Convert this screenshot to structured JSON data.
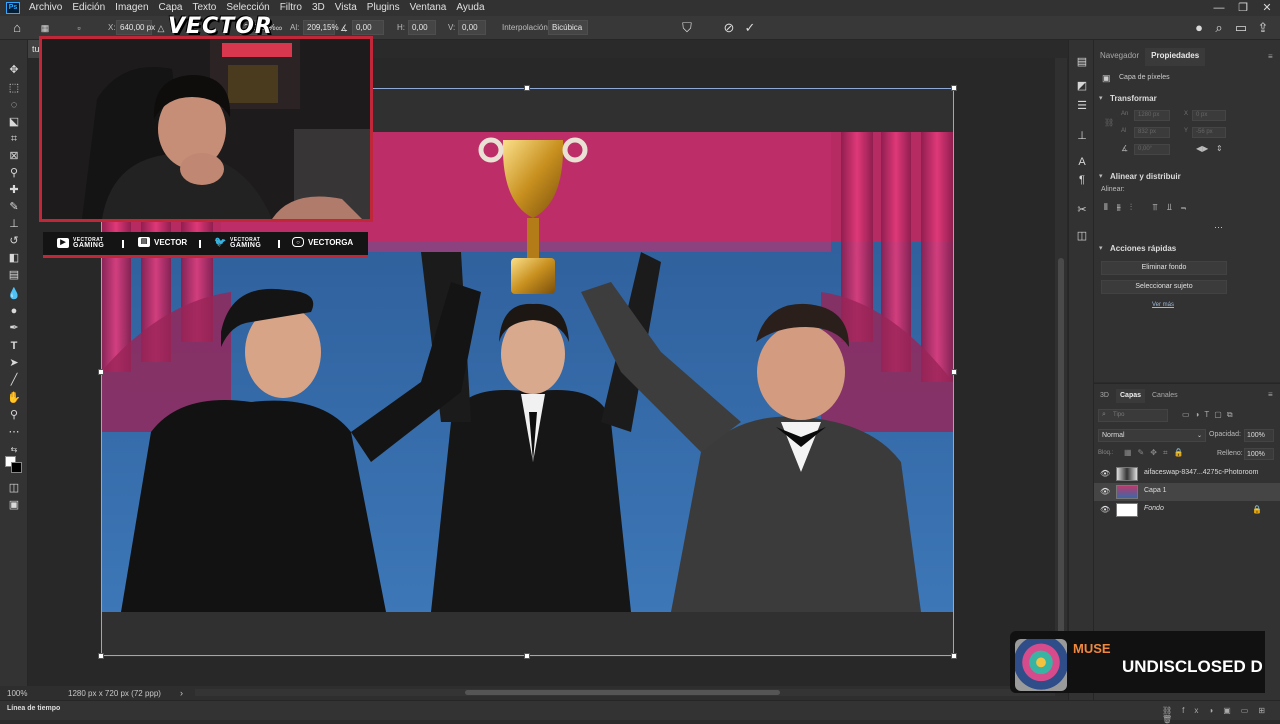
{
  "menu": {
    "items": [
      "Archivo",
      "Edición",
      "Imagen",
      "Capa",
      "Texto",
      "Selección",
      "Filtro",
      "3D",
      "Vista",
      "Plugins",
      "Ventana",
      "Ayuda"
    ]
  },
  "options": {
    "x_label": "X:",
    "x_value": "640,00 px",
    "w_value": "209,15%",
    "h_label": "Al:",
    "h_value": "209,15%",
    "angle_value": "0,00",
    "hskew_label": "H:",
    "hskew_value": "0,00",
    "vskew_label": "V:",
    "vskew_value": "0,00",
    "interp_label": "Interpolación:",
    "interp_value": "Bicúbica"
  },
  "document": {
    "tab_label": "tulo"
  },
  "status": {
    "zoom": "100%",
    "doc_size": "1280 px x 720 px (72 ppp)"
  },
  "timeline": {
    "label": "Línea de tiempo"
  },
  "properties": {
    "tabs": [
      "Navegador",
      "Propiedades"
    ],
    "layer_type": "Capa de píxeles",
    "transform_title": "Transformar",
    "an_label": "An",
    "an_value": "1280 px",
    "x_label": "X",
    "x_value": "0 px",
    "al_label": "Al",
    "al_value": "832 px",
    "y_label": "Y",
    "y_value": "-56 px",
    "angle_value": "0,00°",
    "align_title": "Alinear y distribuir",
    "align_label": "Alinear:",
    "quick_title": "Acciones rápidas",
    "btn_remove_bg": "Eliminar fondo",
    "btn_select_subject": "Seleccionar sujeto",
    "see_more": "Ver más"
  },
  "layers": {
    "tabs": [
      "3D",
      "Capas",
      "Canales"
    ],
    "search_placeholder": "Tipo",
    "blend_mode": "Normal",
    "opacity_label": "Opacidad:",
    "opacity_value": "100%",
    "lock_label": "Bloq.:",
    "fill_label": "Relleno:",
    "fill_value": "100%",
    "items": [
      {
        "name": "aifaceswap-8347...4275c-Photoroom"
      },
      {
        "name": "Capa 1"
      },
      {
        "name": "Fondo"
      }
    ]
  },
  "overlay": {
    "brand": "VECTOR",
    "social": [
      {
        "icon": "youtube-icon",
        "top": "VECTORAT",
        "bottom": "GAMING"
      },
      {
        "icon": "twitch-icon",
        "text": "VECTOR"
      },
      {
        "icon": "twitter-icon",
        "top": "VECTORAT",
        "bottom": "GAMING"
      },
      {
        "icon": "instagram-icon",
        "text": "VECTORGA"
      }
    ]
  },
  "music": {
    "artist": "MUSE",
    "song": "UNDISCLOSED D"
  },
  "colors": {
    "accent_blue": "#31a8ff",
    "overlay_red": "#c0283a",
    "music_orange": "#f0883e"
  }
}
